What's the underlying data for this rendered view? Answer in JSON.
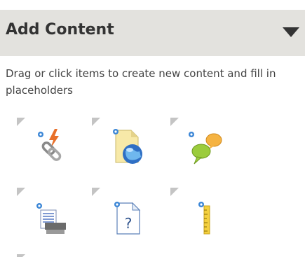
{
  "panel": {
    "title": "Add Content",
    "toggle_icon": "triangle-down-icon",
    "description": "Drag or click items to create new content and fill in placeholders"
  },
  "tiles": [
    {
      "name": "link-tile",
      "icon": "chain-link-lightning-icon"
    },
    {
      "name": "web-page-tile",
      "icon": "globe-document-icon"
    },
    {
      "name": "discussion-tile",
      "icon": "speech-bubbles-icon"
    },
    {
      "name": "printer-tile",
      "icon": "printer-document-icon"
    },
    {
      "name": "question-tile",
      "icon": "question-document-icon"
    },
    {
      "name": "ruler-tile",
      "icon": "ruler-icon"
    },
    {
      "name": "partial-tile",
      "icon": "corner-marker-icon"
    }
  ],
  "colors": {
    "header_bg": "#e3e2de",
    "title_text": "#333333",
    "body_text": "#444444",
    "corner_marker": "#c4c4c4",
    "blue_dot": "#3b86d6"
  }
}
